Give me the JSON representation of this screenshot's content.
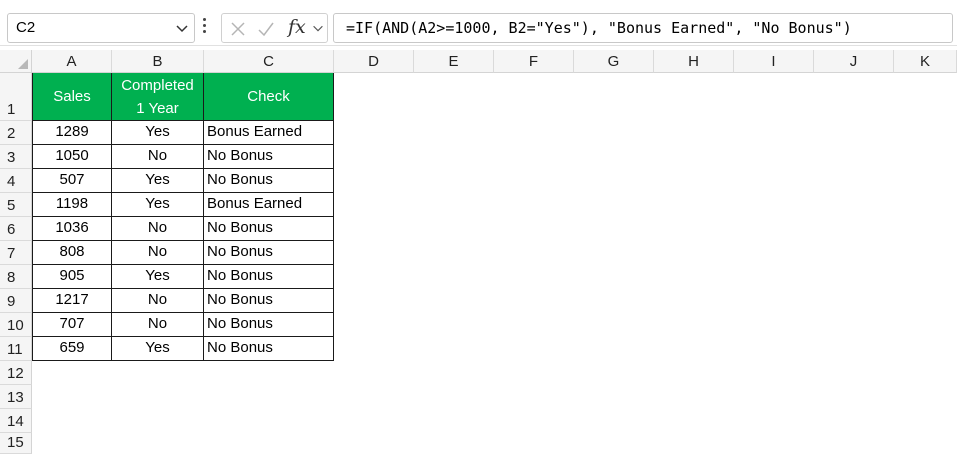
{
  "name_box": {
    "value": "C2"
  },
  "formula_bar": {
    "cancel_icon": "close-x-icon",
    "enter_icon": "checkmark-icon",
    "function_label": "fx",
    "formula": "=IF(AND(A2>=1000, B2=\"Yes\"), \"Bonus Earned\", \"No Bonus\")"
  },
  "columns": [
    "A",
    "B",
    "C",
    "D",
    "E",
    "F",
    "G",
    "H",
    "I",
    "J",
    "K"
  ],
  "rows": [
    "1",
    "2",
    "3",
    "4",
    "5",
    "6",
    "7",
    "8",
    "9",
    "10",
    "11",
    "12",
    "13",
    "14",
    "15"
  ],
  "table": {
    "header_color": "#00b050",
    "headers": {
      "sales": "Sales",
      "completed_line1": "Completed",
      "completed_line2": "1 Year",
      "check": "Check"
    },
    "rows": [
      {
        "sales": "1289",
        "completed": "Yes",
        "check": "Bonus Earned"
      },
      {
        "sales": "1050",
        "completed": "No",
        "check": "No Bonus"
      },
      {
        "sales": "507",
        "completed": "Yes",
        "check": "No Bonus"
      },
      {
        "sales": "1198",
        "completed": "Yes",
        "check": "Bonus Earned"
      },
      {
        "sales": "1036",
        "completed": "No",
        "check": "No Bonus"
      },
      {
        "sales": "808",
        "completed": "No",
        "check": "No Bonus"
      },
      {
        "sales": "905",
        "completed": "Yes",
        "check": "No Bonus"
      },
      {
        "sales": "1217",
        "completed": "No",
        "check": "No Bonus"
      },
      {
        "sales": "707",
        "completed": "No",
        "check": "No Bonus"
      },
      {
        "sales": "659",
        "completed": "Yes",
        "check": "No Bonus"
      }
    ]
  }
}
